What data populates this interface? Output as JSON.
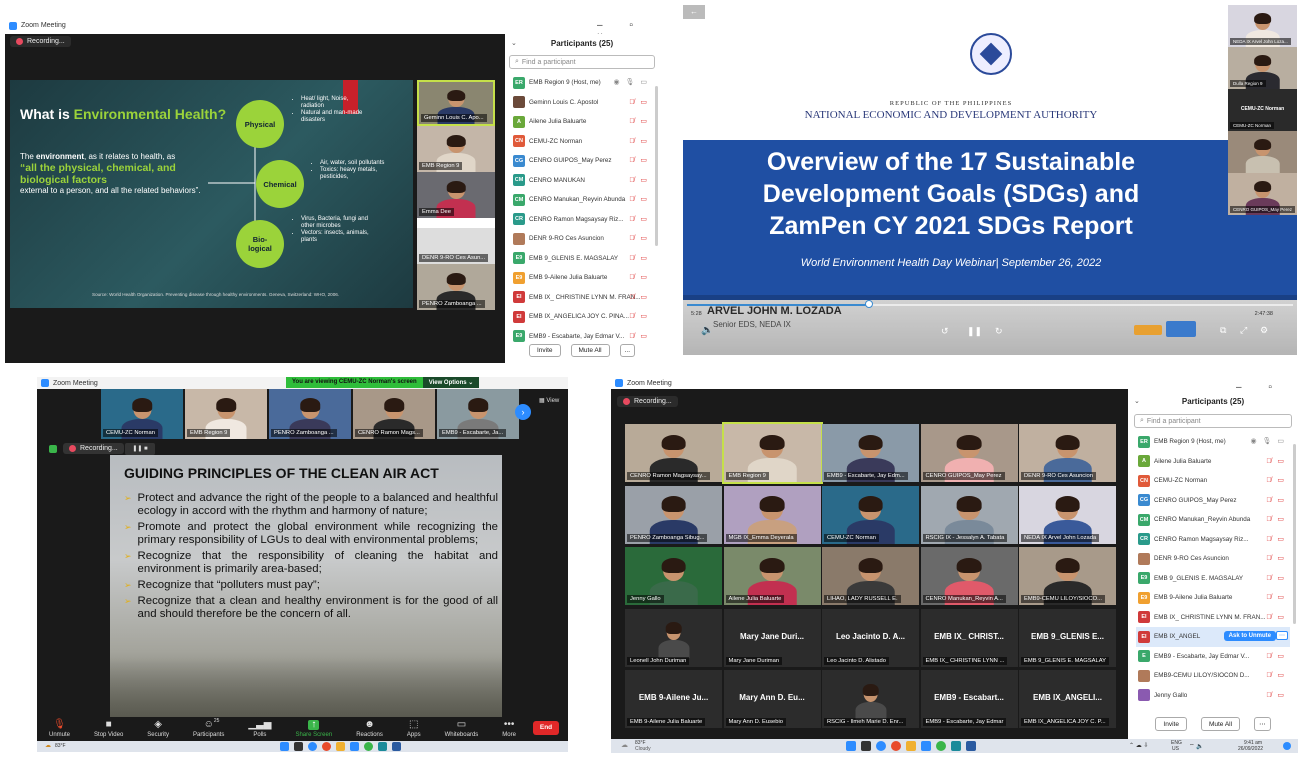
{
  "q1": {
    "app_title": "Zoom Meeting",
    "recording_label": "Recording...",
    "slide": {
      "title_a": "What is ",
      "title_b": "Environmental Health?",
      "body_a": "The ",
      "body_b": "environment",
      "body_c": ", as it relates to health, as",
      "quote": "“all the physical, chemical, and biological factors",
      "body_d": " external to a person, and all the related behaviors”.",
      "circles": [
        "Physical",
        "Chemical",
        "Bio-\nlogical"
      ],
      "physical_points": [
        "Heat/ light, Noise, radiation",
        "Natural and man-made disasters"
      ],
      "chemical_points": [
        "Air, water, soil pollutants",
        "Toxics: heavy metals, pesticides,"
      ],
      "bio_points": [
        "Virus, Bacteria, fungi and other microbes",
        "Vectors: insects, animals, plants"
      ],
      "source": "Source: World Health Organization. Preventing disease through healthy environments. Geneva, Switzerland: WHO, 2006."
    },
    "thumbs": [
      "Geminn Louis C. Apo...",
      "EMB Region 9",
      "Emma Dee",
      "DENR 9-RO Ces Asun...",
      "PENRO Zamboanga ..."
    ],
    "participants_title": "Participants (25)",
    "search_placeholder": "Find a participant",
    "participants": [
      {
        "initials": "ER",
        "name": "EMB Region 9 (Host, me)",
        "color": "#3aa86b"
      },
      {
        "initials": "",
        "name": "Geminn Louis C. Apostol",
        "color": "#6b4a3a"
      },
      {
        "initials": "A",
        "name": "Ailene Julia Baluarte",
        "color": "#6aa83a"
      },
      {
        "initials": "CN",
        "name": "CEMU-ZC Norman",
        "color": "#e05a3a"
      },
      {
        "initials": "CG",
        "name": "CENRO GUIPOS_May Perez",
        "color": "#3a8ad0"
      },
      {
        "initials": "CM",
        "name": "CENRO MANUKAN",
        "color": "#2a9a8a"
      },
      {
        "initials": "CM",
        "name": "CENRO Manukan_Reyvin Abunda",
        "color": "#3aa86b"
      },
      {
        "initials": "CR",
        "name": "CENRO Ramon Magsaysay Riz...",
        "color": "#2a9a8a"
      },
      {
        "initials": "",
        "name": "DENR 9-RO Ces Asuncion",
        "color": "#b07a5a"
      },
      {
        "initials": "E9",
        "name": "EMB 9_GLENIS E. MAGSALAY",
        "color": "#3aa86b"
      },
      {
        "initials": "E9",
        "name": "EMB 9-Ailene Julia Baluarte",
        "color": "#f0a030"
      },
      {
        "initials": "EI",
        "name": "EMB IX_ CHRISTINE LYNN M. FRAN...",
        "color": "#d03a3a"
      },
      {
        "initials": "EI",
        "name": "EMB IX_ANGELICA JOY C. PINA...",
        "color": "#d03a3a"
      },
      {
        "initials": "E9",
        "name": "EMB9 - Escabarte, Jay Edmar V...",
        "color": "#3aa86b"
      }
    ],
    "invite_label": "Invite",
    "muteall_label": "Mute All",
    "more_label": "..."
  },
  "q2": {
    "republic": "REPUBLIC OF THE PHILIPPINES",
    "neda": "NATIONAL ECONOMIC AND DEVELOPMENT AUTHORITY",
    "title1": "Overview of the 17 Sustainable",
    "title2": "Development Goals (SDGs) and",
    "title3": "ZamPen CY 2021 SDGs Report",
    "subtitle": "World Environment Health Day Webinar| September 26, 2022",
    "speaker_name": "ARVEL JOHN M. LOZADA",
    "speaker_title": "Senior EDS, NEDA IX",
    "thumbs": [
      "NEDA IX Arvel John Loza...",
      "Dulla Region 9",
      "CEMU-ZC Norman",
      "CEMU-ZC Norman",
      "CENRO GUIPOS_May Perez"
    ],
    "time_left": "5:28",
    "time_right": "2:47:38",
    "progress": 0.3
  },
  "q3": {
    "app_title": "Zoom Meeting",
    "viewing_banner": "You are viewing CEMU-ZC Norman's screen",
    "view_options": "View Options",
    "view_label": "View",
    "recording_label": "Recording...",
    "thumbs": [
      "CEMU-ZC Norman",
      "EMB Region 9",
      "PENRO Zamboanga ...",
      "CENRO Ramon Mags...",
      "EMB9 - Escabarte, Ja..."
    ],
    "slide_title": "GUIDING PRINCIPLES OF THE CLEAN AIR ACT",
    "bullets": [
      "Protect and advance the right of the people to a balanced and healthful ecology in accord with the rhythm and harmony of nature;",
      "Promote and protect the global environment while recognizing the primary responsibility of LGUs to deal with environmental problems;",
      "Recognize that the responsibility of cleaning the habitat and environment is primarily area-based;",
      "Recognize that “polluters must pay”;",
      "Recognize that a clean and healthy environment is for the good of all and should therefore be the concern of all."
    ],
    "toolbar": [
      {
        "icon": "🎙",
        "label": "Unmute"
      },
      {
        "icon": "■",
        "label": "Stop Video"
      },
      {
        "icon": "◈",
        "label": "Security"
      },
      {
        "icon": "☺",
        "label": "Participants",
        "badge": "25"
      },
      {
        "icon": "▁▃▅",
        "label": "Polls"
      },
      {
        "icon": "↑",
        "label": "Share Screen"
      },
      {
        "icon": "☻",
        "label": "Reactions"
      },
      {
        "icon": "⬚",
        "label": "Apps"
      },
      {
        "icon": "▭",
        "label": "Whiteboards"
      },
      {
        "icon": "•••",
        "label": "More"
      }
    ],
    "end_label": "End",
    "weather": "83°F"
  },
  "q4": {
    "app_title": "Zoom Meeting",
    "recording_label": "Recording...",
    "tiles": [
      "CENRO Ramon Magsaysay...",
      "EMB Region 9",
      "EMB9 - Escabarte, Jay Edm...",
      "CENRO GUIPOS_May Perez",
      "DENR 9-RO Ces Asuncion",
      "PENRO Zamboanga Sibug...",
      "MGB IX_Emma Deyerala",
      "CEMU-ZC Norman",
      "RSCIG IX - Jessalyn A. Tabata",
      "NEDA IX Arvel John Lozada",
      "Jenny Gallo",
      "Ailene Julia Baluarte",
      "LIHAO, LADY RUSSELL E.",
      "CENRO Manukan_Reyvin A...",
      "EMB9-CEMU LILOY/SIOCO...",
      "Leonell John Duriman",
      "Mary Jane Duriman",
      "Leo Jacinto D. Alistado",
      "EMB IX_ CHRISTINE LYNN ...",
      "EMB 9_GLENIS E. MAGSALAY",
      "EMB 9-Ailene Julia Baluarte",
      "Mary Ann D. Eusebio",
      "RSCIG - Ilmeh Marie D. Enr...",
      "EMB9 - Escabarte, Jay Edmar",
      "EMB IX_ANGELICA JOY C. P..."
    ],
    "big_names": {
      "16": "Mary Jane Duri...",
      "17": "Leo Jacinto D. A...",
      "18": "EMB IX_ CHRIST...",
      "19": "EMB 9_GLENIS E...",
      "20": "EMB 9-Ailene Ju...",
      "21": "Mary Ann D. Eu...",
      "23": "EMB9 - Escabart...",
      "24": "EMB IX_ANGELI..."
    },
    "participants_title": "Participants (25)",
    "search_placeholder": "Find a participant",
    "participants": [
      {
        "initials": "ER",
        "name": "EMB Region 9 (Host, me)",
        "color": "#3aa86b"
      },
      {
        "initials": "A",
        "name": "Ailene Julia Baluarte",
        "color": "#6aa83a"
      },
      {
        "initials": "CN",
        "name": "CEMU-ZC Norman",
        "color": "#e05a3a"
      },
      {
        "initials": "CG",
        "name": "CENRO GUIPOS_May Perez",
        "color": "#3a8ad0"
      },
      {
        "initials": "CM",
        "name": "CENRO Manukan_Reyvin Abunda",
        "color": "#3aa86b"
      },
      {
        "initials": "CR",
        "name": "CENRO Ramon Magsaysay Riz...",
        "color": "#2a9a8a"
      },
      {
        "initials": "",
        "name": "DENR 9-RO Ces Asuncion",
        "color": "#b07a5a"
      },
      {
        "initials": "E9",
        "name": "EMB 9_GLENIS E. MAGSALAY",
        "color": "#3aa86b"
      },
      {
        "initials": "E9",
        "name": "EMB 9-Ailene Julia Baluarte",
        "color": "#f0a030"
      },
      {
        "initials": "EI",
        "name": "EMB IX_ CHRISTINE LYNN M. FRAN...",
        "color": "#d03a3a"
      },
      {
        "initials": "EI",
        "name": "EMB IX_ANGEL",
        "color": "#d03a3a"
      },
      {
        "initials": "E",
        "name": "EMB9 - Escabarte, Jay Edmar V...",
        "color": "#3aa86b"
      },
      {
        "initials": "",
        "name": "EMB9-CEMU LILOY/SIOCON D...",
        "color": "#b07a5a"
      },
      {
        "initials": "",
        "name": "Jenny Gallo",
        "color": "#8a5ab0"
      }
    ],
    "ask_to_unmute": "Ask to Unmute",
    "invite_label": "Invite",
    "muteall_label": "Mute All",
    "weather_temp": "83°F",
    "weather_desc": "Cloudy",
    "lang": "ENG",
    "region": "US",
    "time": "9:41 am",
    "date": "26/09/2022"
  }
}
